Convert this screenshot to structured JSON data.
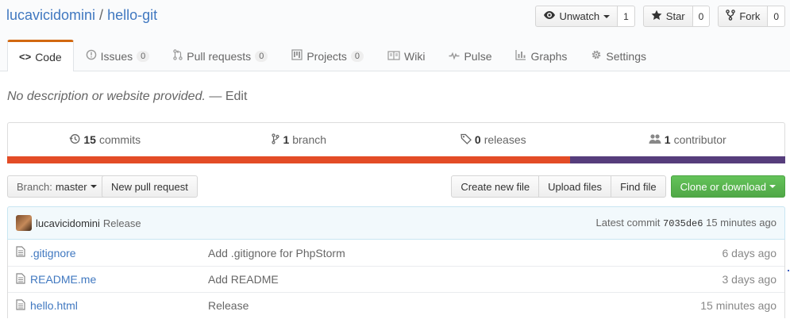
{
  "repo": {
    "owner": "lucavicidomini",
    "separator": "/",
    "name": "hello-git"
  },
  "actions": {
    "watch": {
      "label": "Unwatch",
      "count": "1"
    },
    "star": {
      "label": "Star",
      "count": "0"
    },
    "fork": {
      "label": "Fork",
      "count": "0"
    }
  },
  "nav": {
    "code": "Code",
    "issues": {
      "label": "Issues",
      "count": "0"
    },
    "pulls": {
      "label": "Pull requests",
      "count": "0"
    },
    "projects": {
      "label": "Projects",
      "count": "0"
    },
    "wiki": "Wiki",
    "pulse": "Pulse",
    "graphs": "Graphs",
    "settings": "Settings"
  },
  "description": {
    "text": "No description or website provided.",
    "dash": "—",
    "edit": "Edit"
  },
  "summary": {
    "commits": {
      "count": "15",
      "label": "commits"
    },
    "branches": {
      "count": "1",
      "label": "branch"
    },
    "releases": {
      "count": "0",
      "label": "releases"
    },
    "contributors": {
      "count": "1",
      "label": "contributor"
    }
  },
  "languages": [
    {
      "color": "#e34c26",
      "percent": 72.3
    },
    {
      "color": "#563d7c",
      "percent": 27.7
    }
  ],
  "file_nav": {
    "branch_label": "Branch:",
    "branch_name": "master",
    "new_pr": "New pull request",
    "create_file": "Create new file",
    "upload_files": "Upload files",
    "find_file": "Find file",
    "clone": "Clone or download"
  },
  "latest_commit": {
    "author": "lucavicidomini",
    "message": "Release",
    "prefix": "Latest commit",
    "sha": "7035de6",
    "age": "15 minutes ago"
  },
  "files": [
    {
      "name": ".gitignore",
      "commit": "Add .gitignore for PhpStorm",
      "age": "6 days ago"
    },
    {
      "name": "README.me",
      "commit": "Add README",
      "age": "3 days ago"
    },
    {
      "name": "hello.html",
      "commit": "Release",
      "age": "15 minutes ago"
    }
  ]
}
